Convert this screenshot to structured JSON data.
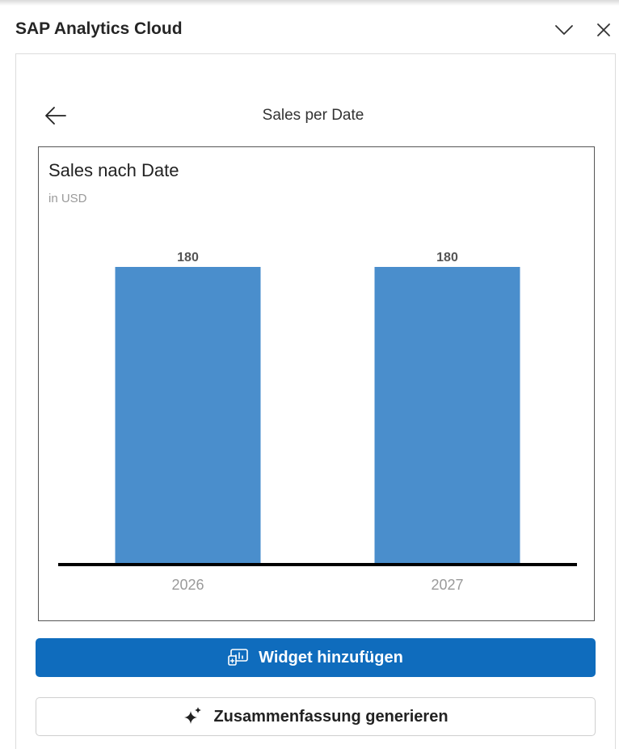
{
  "app": {
    "title": "SAP Analytics Cloud"
  },
  "nav": {
    "title": "Sales per Date"
  },
  "chart_data": {
    "type": "bar",
    "title": "Sales nach Date",
    "subtitle": "in USD",
    "categories": [
      "2026",
      "2027"
    ],
    "values": [
      180,
      180
    ],
    "ylim": [
      0,
      180
    ],
    "grid": false,
    "bar_color": "#4a8ecc"
  },
  "actions": {
    "add_widget_label": "Widget hinzufügen",
    "generate_summary_label": "Zusammenfassung generieren"
  },
  "colors": {
    "primary": "#0f6cbd",
    "bar": "#4a8ecc"
  },
  "icons": {
    "collapse": "chevron-down-icon",
    "close": "close-icon",
    "back": "arrow-left-icon",
    "widget": "widget-chart-icon",
    "summary": "sparkle-icon"
  }
}
